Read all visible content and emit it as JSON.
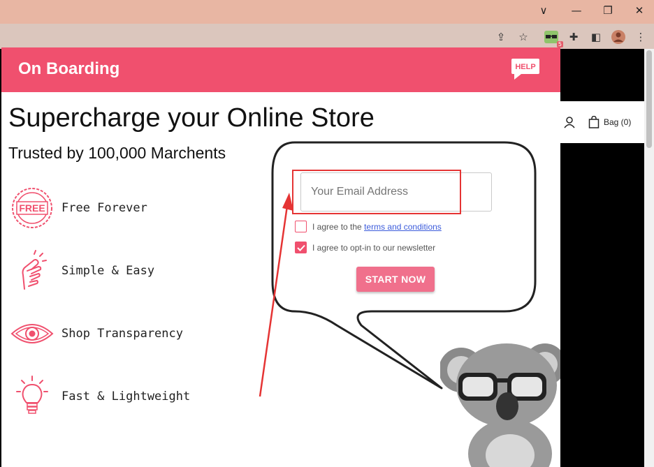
{
  "browser": {
    "window_controls": {
      "collapse": "∨",
      "minimize": "—",
      "restore": "❐",
      "close": "✕"
    },
    "toolbar": {
      "share": "⇪",
      "bookmark": "☆",
      "extensions": "✚",
      "sidepanel": "◧",
      "menu": "⋮",
      "ext_badge": "5"
    }
  },
  "site": {
    "bag_label": "Bag (0)"
  },
  "modal": {
    "title": "On Boarding",
    "help_label": "HELP",
    "headline": "Supercharge your Online Store",
    "subline": "Trusted by 100,000 Marchents",
    "features": [
      {
        "label": "Free Forever",
        "badge": "FREE"
      },
      {
        "label": "Simple & Easy"
      },
      {
        "label": "Shop Transparency"
      },
      {
        "label": "Fast & Lightweight"
      }
    ],
    "form": {
      "email_placeholder": "Your Email Address",
      "terms_prefix": "I agree to the ",
      "terms_link": "terms and conditions",
      "terms_checked": false,
      "newsletter_label": "I agree to opt-in to our newsletter",
      "newsletter_checked": true,
      "start_label": "START NOW"
    }
  },
  "colors": {
    "brand": "#f0506e",
    "button": "#f0708c",
    "annotation": "#e53434"
  }
}
